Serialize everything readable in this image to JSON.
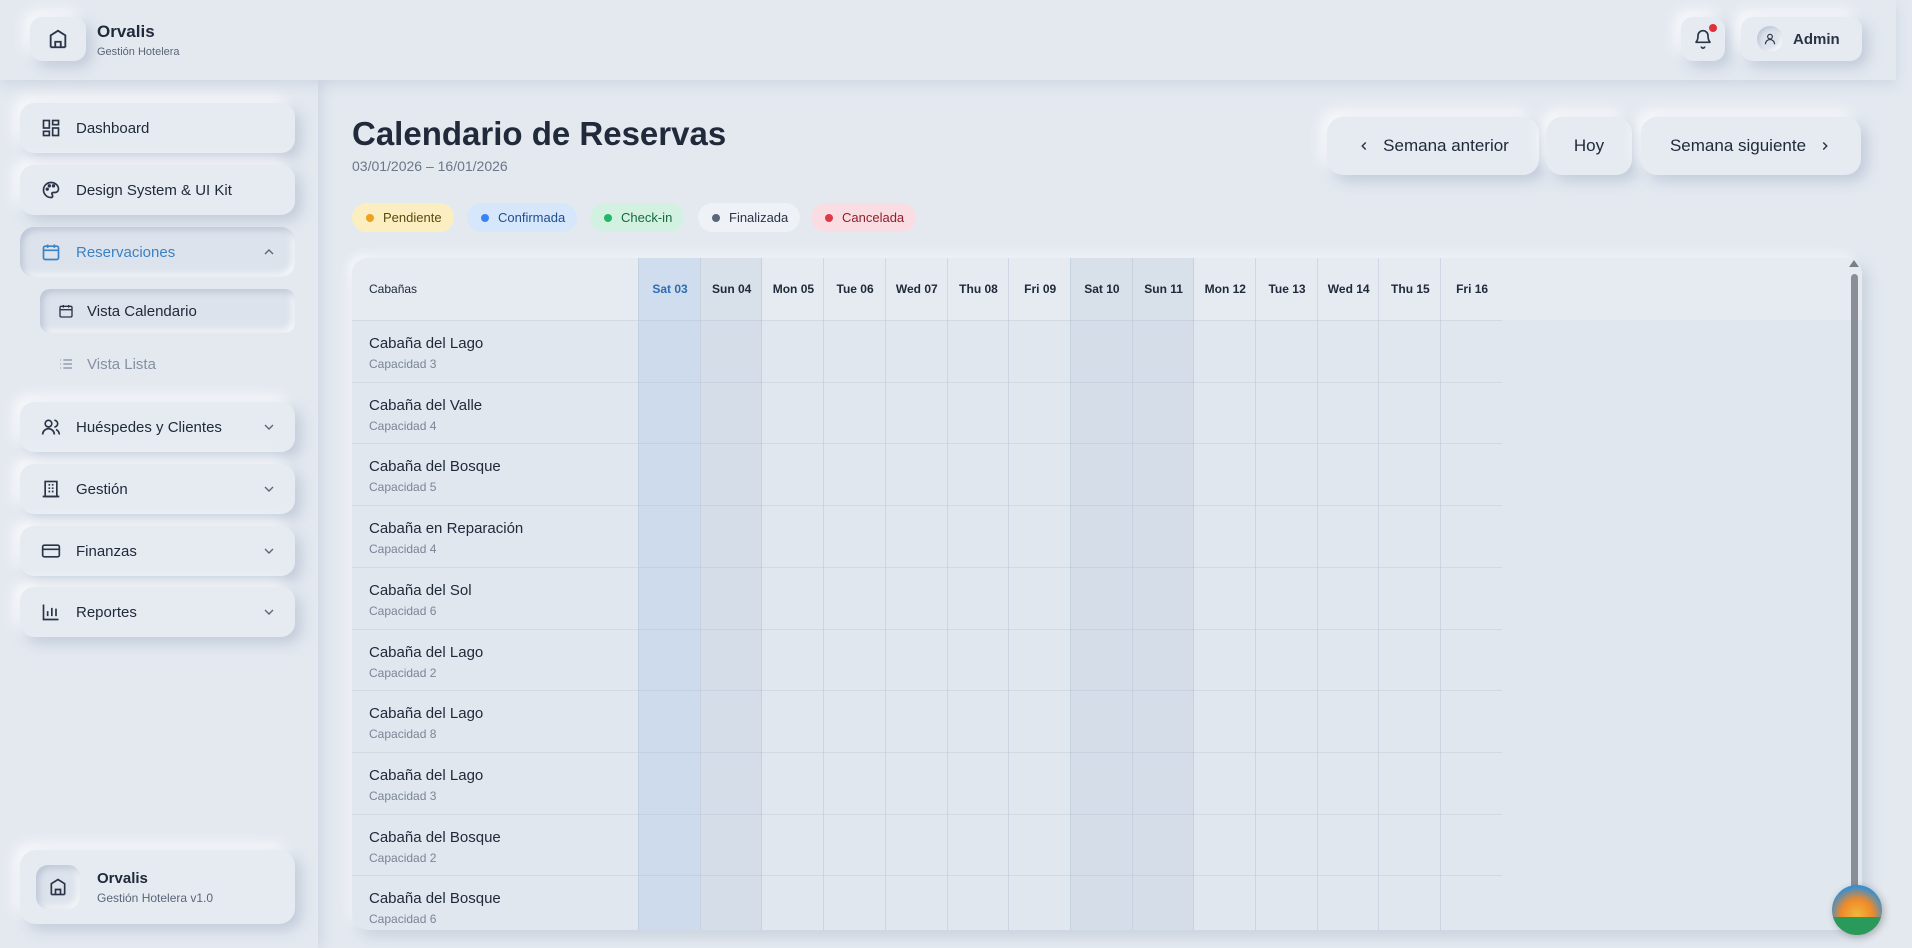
{
  "header": {
    "brand_name": "Orvalis",
    "brand_sub": "Gestión Hotelera",
    "user_label": "Admin"
  },
  "sidebar": {
    "items": [
      {
        "label": "Dashboard",
        "icon": "dashboard-icon"
      },
      {
        "label": "Design System & UI Kit",
        "icon": "palette-icon"
      },
      {
        "label": "Reservaciones",
        "icon": "calendar-icon",
        "expanded": true
      },
      {
        "label": "Huéspedes y Clientes",
        "icon": "users-icon"
      },
      {
        "label": "Gestión",
        "icon": "building-icon"
      },
      {
        "label": "Finanzas",
        "icon": "credit-card-icon"
      },
      {
        "label": "Reportes",
        "icon": "bar-chart-icon"
      }
    ],
    "subitems": [
      {
        "label": "Vista Calendario",
        "icon": "calendar-small-icon",
        "active": true
      },
      {
        "label": "Vista Lista",
        "icon": "list-icon"
      }
    ],
    "footer": {
      "name": "Orvalis",
      "sub": "Gestión Hotelera v1.0"
    }
  },
  "main": {
    "title": "Calendario de Reservas",
    "range": "03/01/2026 – 16/01/2026",
    "prev_label": "Semana anterior",
    "today_label": "Hoy",
    "next_label": "Semana siguiente",
    "legend": [
      {
        "label": "Pendiente",
        "color": "#f0a020",
        "bg": "#fbefc2",
        "text": "#5a4a10"
      },
      {
        "label": "Confirmada",
        "color": "#3b82f6",
        "bg": "#d6e6fb",
        "text": "#1e4f8f"
      },
      {
        "label": "Check-in",
        "color": "#22b86a",
        "bg": "#d3f1e0",
        "text": "#16683e"
      },
      {
        "label": "Finalizada",
        "color": "#5b6677",
        "bg": "#eef1f5",
        "text": "#2a3446"
      },
      {
        "label": "Cancelada",
        "color": "#e0384a",
        "bg": "#fadde2",
        "text": "#8f1f2c"
      }
    ],
    "calendar": {
      "cabins_header": "Cabañas",
      "days": [
        "Sat 03",
        "Sun 04",
        "Mon 05",
        "Tue 06",
        "Wed 07",
        "Thu 08",
        "Fri 09",
        "Sat 10",
        "Sun 11",
        "Mon 12",
        "Tue 13",
        "Wed 14",
        "Thu 15",
        "Fri 16"
      ],
      "rows": [
        {
          "name": "Cabaña del Lago",
          "cap": "Capacidad 3"
        },
        {
          "name": "Cabaña del Valle",
          "cap": "Capacidad 4"
        },
        {
          "name": "Cabaña del Bosque",
          "cap": "Capacidad 5"
        },
        {
          "name": "Cabaña en Reparación",
          "cap": "Capacidad 4"
        },
        {
          "name": "Cabaña del Sol",
          "cap": "Capacidad 6"
        },
        {
          "name": "Cabaña del Lago",
          "cap": "Capacidad 2"
        },
        {
          "name": "Cabaña del Lago",
          "cap": "Capacidad 8"
        },
        {
          "name": "Cabaña del Lago",
          "cap": "Capacidad 3"
        },
        {
          "name": "Cabaña del Bosque",
          "cap": "Capacidad 2"
        },
        {
          "name": "Cabaña del Bosque",
          "cap": "Capacidad 6"
        }
      ]
    }
  },
  "colors": {
    "accent": "#3b82c4",
    "background": "#e4e9f0"
  }
}
